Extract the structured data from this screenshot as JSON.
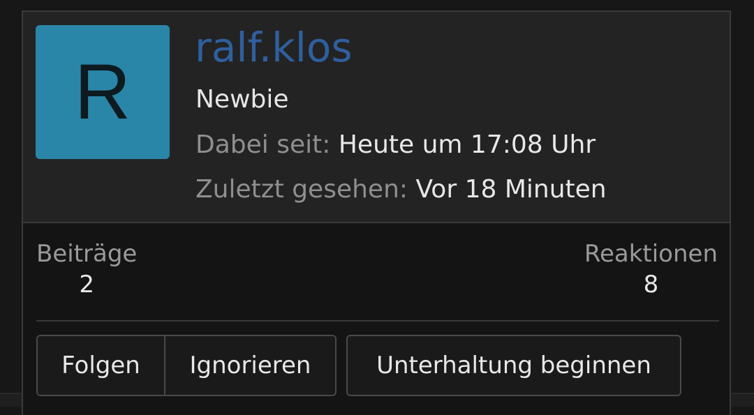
{
  "profile": {
    "avatar_letter": "R",
    "avatar_color": "#2a86a8",
    "username": "ralf.klos",
    "username_color": "#2f5f9e",
    "user_title": "Newbie",
    "joined_label": "Dabei seit:",
    "joined_value": "Heute um 17:08 Uhr",
    "last_seen_label": "Zuletzt gesehen:",
    "last_seen_value": "Vor 18 Minuten"
  },
  "stats": {
    "posts_label": "Beiträge",
    "posts_value": "2",
    "reactions_label": "Reaktionen",
    "reactions_value": "8"
  },
  "actions": {
    "follow_label": "Folgen",
    "ignore_label": "Ignorieren",
    "conversation_label": "Unterhaltung beginnen"
  }
}
